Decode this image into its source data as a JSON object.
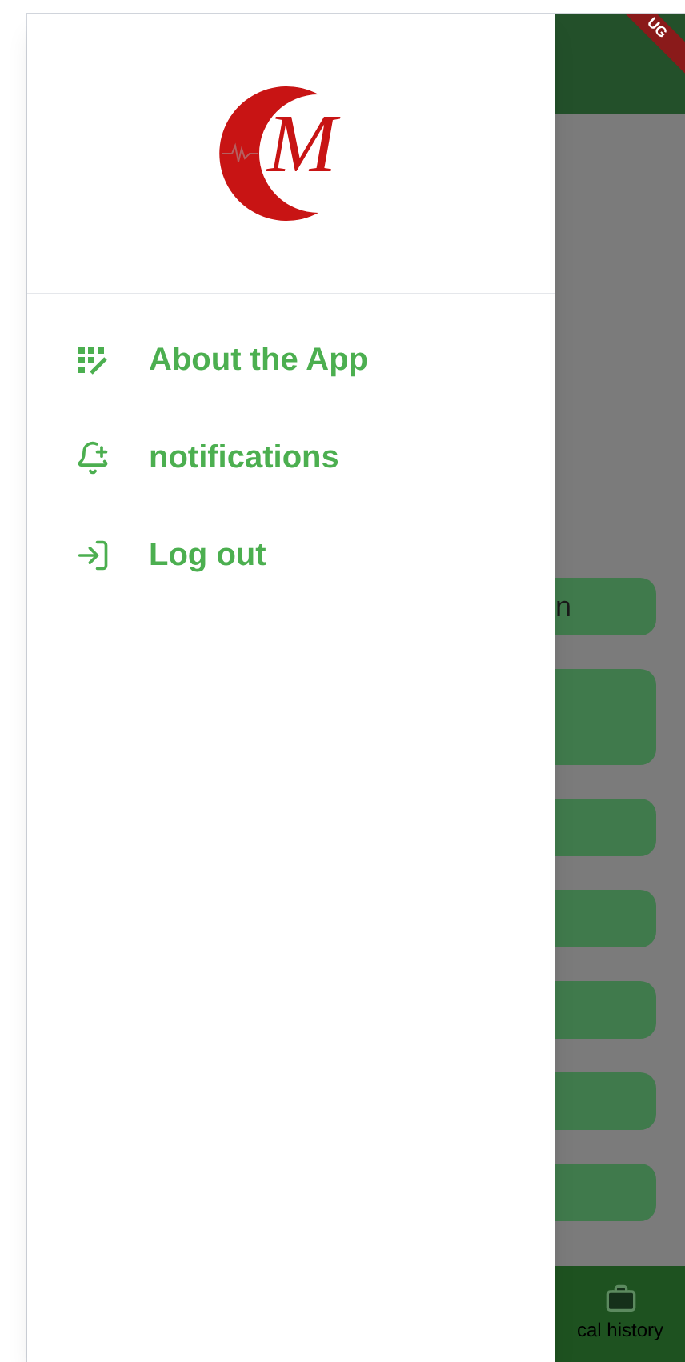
{
  "logo": {
    "monogram": "M"
  },
  "drawer": {
    "items": [
      {
        "kind": "about",
        "label": "About the App"
      },
      {
        "kind": "notifications",
        "label": "notifications"
      },
      {
        "kind": "logout",
        "label": "Log out"
      }
    ]
  },
  "background": {
    "debug_banner": "UG",
    "buttons": [
      {
        "kind": "short",
        "text": "n"
      },
      {
        "kind": "tall"
      },
      {
        "kind": "short"
      },
      {
        "kind": "short"
      },
      {
        "kind": "short"
      },
      {
        "kind": "short"
      },
      {
        "kind": "short"
      }
    ],
    "nav_label": "cal history"
  }
}
